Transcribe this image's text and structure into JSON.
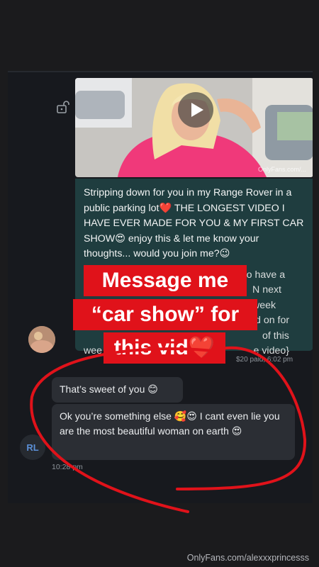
{
  "post": {
    "video": {
      "watermark": "OnlyFans.com/..."
    },
    "caption": {
      "visible_text": "Stripping down for you in my Range Rover in a public parking lot❤️ THE LONGEST VIDEO I HAVE EVER MADE FOR YOU & MY FIRST CAR SHOW😍 enjoy this & let me know your thoughts... would you join me?😉",
      "partial_line_1": "ng to have a",
      "partial_line_2": "N next week",
      "partial_line_3": "d on for",
      "partial_line_4": "of this",
      "partial_line_5a": "wee",
      "partial_line_5b": "e video}"
    },
    "meta": "$20 paid, 6:02 pm"
  },
  "overlay": {
    "line_1": "Message me",
    "line_2": "“car show” for",
    "line_3": "this vid❤️"
  },
  "fan": {
    "avatar_initials": "RL",
    "message_1": "That’s sweet of you 😊",
    "message_2": "Ok you’re something else 🥰😍 I cant even lie you are the most beautiful woman on earth 😍",
    "time": "10:28 pm"
  },
  "footer": {
    "watermark": "OnlyFans.com/alexxxprincesss"
  },
  "colors": {
    "sticker_red": "#e0121a",
    "caption_bubble": "#1f3d3f",
    "fan_bubble": "#2b2e34",
    "background": "#1b1b1d"
  }
}
